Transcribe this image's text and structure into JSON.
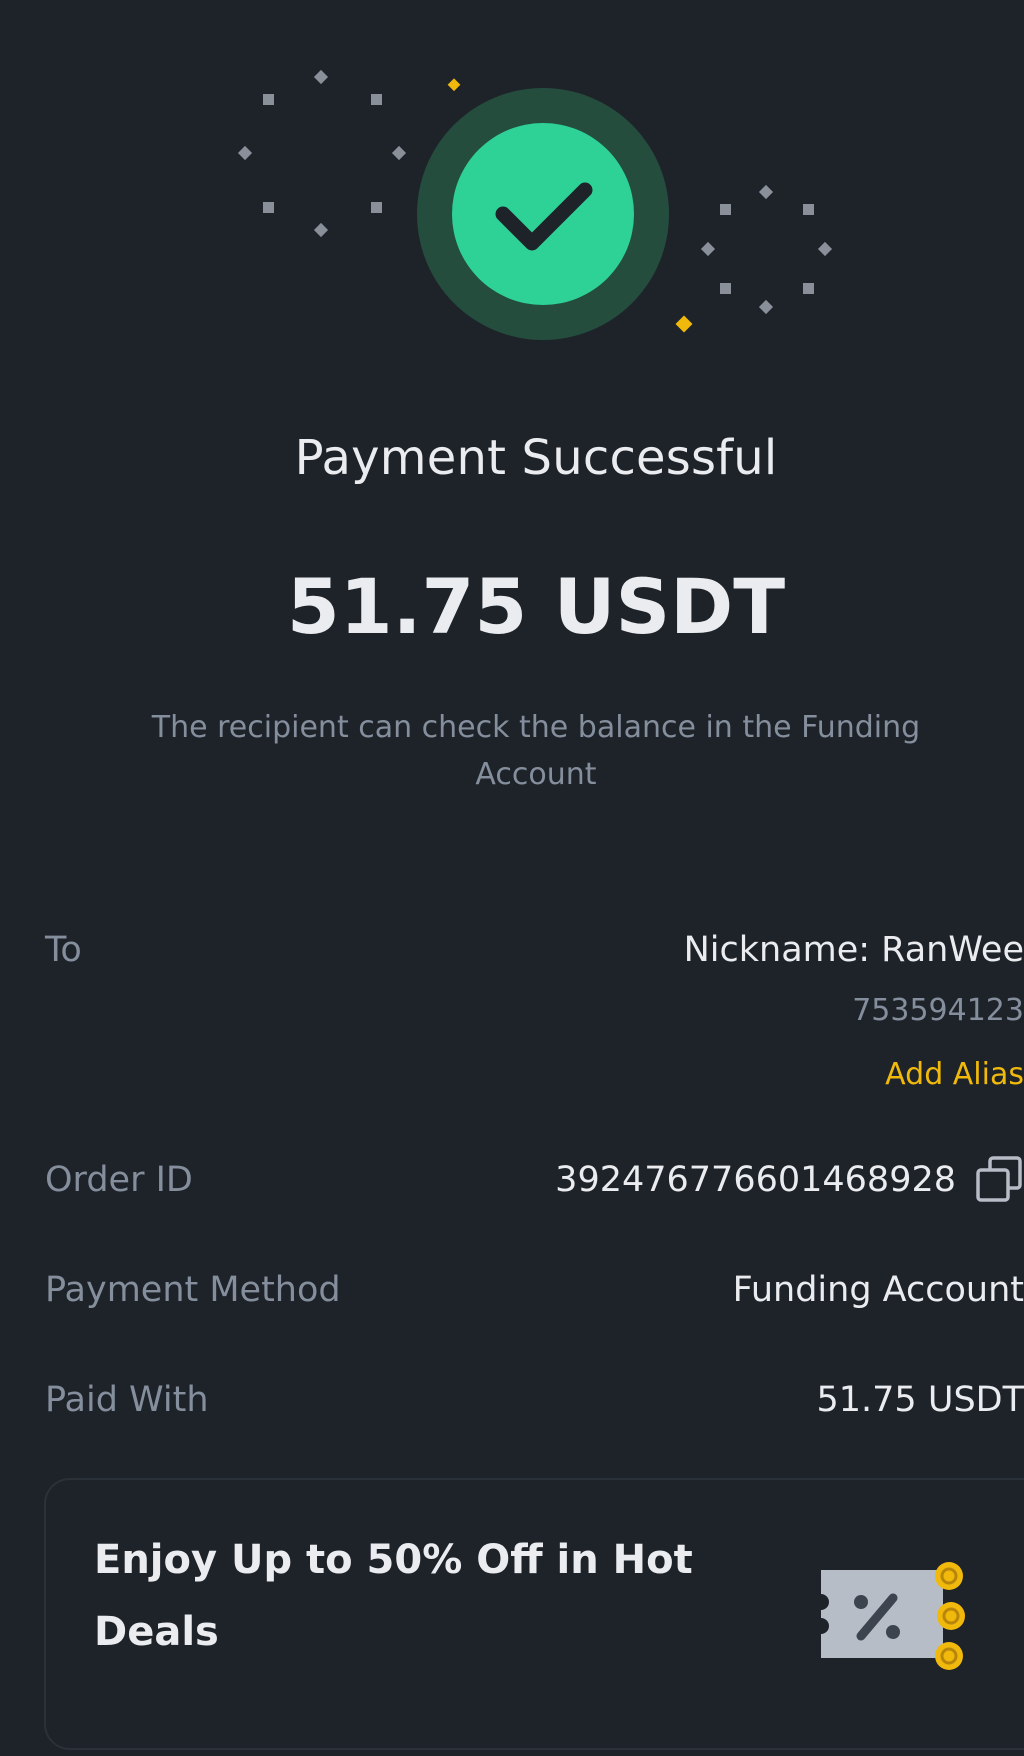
{
  "status": {
    "title": "Payment Successful",
    "amount": "51.75 USDT",
    "note": "The recipient can check the balance in the Funding Account"
  },
  "details": {
    "to_label": "To",
    "nickname": "Nickname: RanWee",
    "uid": "753594123",
    "add_alias_label": "Add Alias",
    "order_id_label": "Order ID",
    "order_id_value": "392476776601468928",
    "payment_method_label": "Payment Method",
    "payment_method_value": "Funding Account",
    "paid_with_label": "Paid With",
    "paid_with_value": "51.75 USDT"
  },
  "promo": {
    "text": "Enjoy Up to 50% Off in Hot Deals"
  },
  "colors": {
    "background": "#1e2329",
    "success_green": "#2ed297",
    "accent_yellow": "#f0b90b",
    "muted_text": "#848e9c"
  },
  "icons": [
    "success-check-icon",
    "copy-icon",
    "discount-coupon-icon"
  ]
}
